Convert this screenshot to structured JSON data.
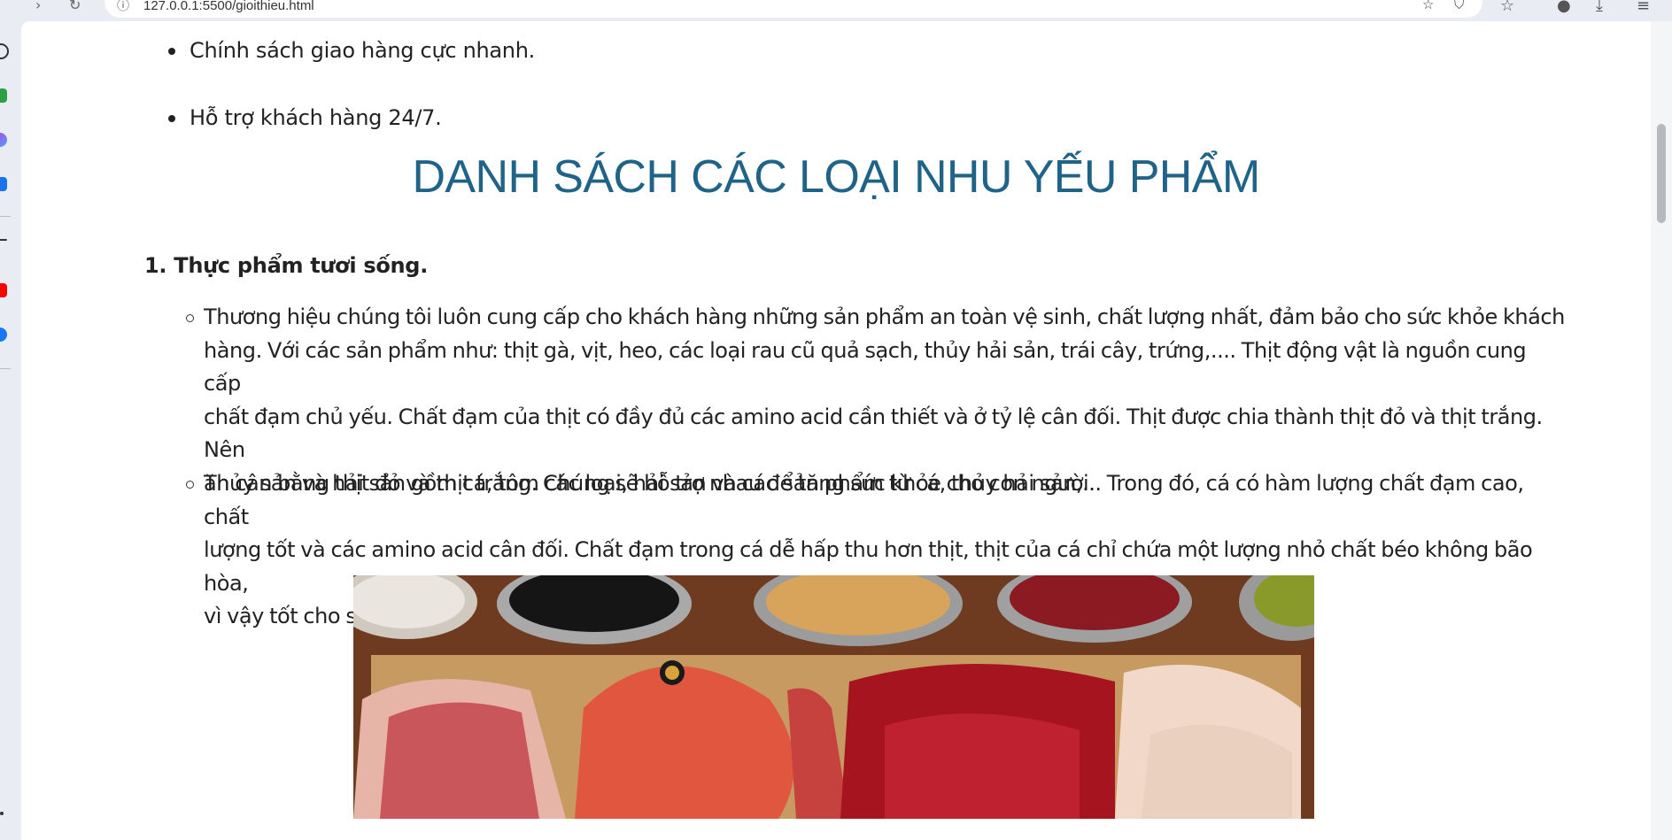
{
  "browser": {
    "url": "127.0.0.1:5500/gioithieu.html"
  },
  "content": {
    "top_bullets": [
      "Chính sách giao hàng cực nhanh.",
      "Hỗ trợ khách hàng 24/7."
    ],
    "heading": "DANH SÁCH CÁC LOẠI NHU YẾU PHẨM",
    "section_title": "1. Thực phẩm tươi sống.",
    "paragraph1_lines": [
      "Thương hiệu chúng tôi luôn cung cấp cho khách hàng những sản phẩm an toàn vệ sinh, chất lượng nhất, đảm bảo cho sức khỏe khách",
      "hàng. Với các sản phẩm như: thịt gà, vịt, heo, các loại rau cũ quả sạch, thủy hải sản, trái cây, trứng,.... Thịt động vật là nguồn cung cấp",
      "chất đạm chủ yếu. Chất đạm của thịt có đầy đủ các amino acid cần thiết và ở tỷ lệ cân đối. Thịt được chia thành thịt đỏ và thịt trắng. Nên",
      "ăn cân bằng thịt đỏ và thịt trắng. Chúng sẽ hỗ trợ nhau để tăng sức khỏe cho con người."
    ],
    "paragraph2_lines": [
      "Thủy sản và hải sản gồm cá, tôm các loại, hải sản và các sản phẩm từ cá, thủy hải sản,... Trong đó, cá có hàm lượng chất đạm cao, chất",
      "lượng tốt và các amino acid cân đối. Chất đạm trong cá dễ hấp thu hơn thịt, thịt của cá chỉ chứa một lượng nhỏ chất béo không bão hòa,",
      "vì vậy tốt cho sức khỏe, đặc biệt là tốt hệ tiêu hóa và tim mạch."
    ]
  },
  "icons": {
    "back": "back-arrow-icon",
    "reload": "reload-icon",
    "info": "info-icon",
    "bookmark": "star-icon",
    "shield": "shield-icon",
    "favorites": "favorites-icon",
    "profile": "profile-icon",
    "downloads": "download-icon",
    "menu": "menu-icon"
  },
  "colors": {
    "heading": "#1f6389",
    "text": "#222222",
    "page_bg": "#ffffff",
    "chrome_bg": "#e9ecf2"
  }
}
